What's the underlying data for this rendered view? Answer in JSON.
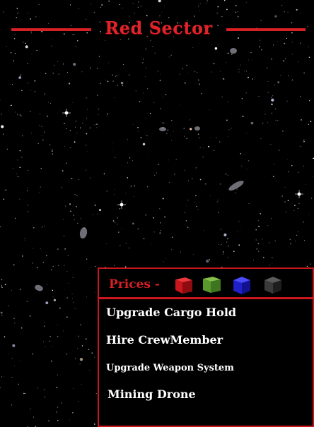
{
  "header": {
    "title": "Red Sector"
  },
  "shop": {
    "prices_label": "Prices -",
    "resources": [
      {
        "icon": "red-cube-icon",
        "color": "#c8161c"
      },
      {
        "icon": "green-cube-icon",
        "color": "#5a9a2c"
      },
      {
        "icon": "blue-cube-icon",
        "color": "#2020c8"
      },
      {
        "icon": "gray-cube-icon",
        "color": "#3a3a3a"
      }
    ],
    "items": [
      {
        "label": "Upgrade Cargo Hold"
      },
      {
        "label": "Hire CrewMember"
      },
      {
        "label": "Upgrade Weapon System"
      },
      {
        "label": "Mining Drone"
      }
    ]
  },
  "colors": {
    "accent": "#d62023",
    "background": "#000000"
  }
}
